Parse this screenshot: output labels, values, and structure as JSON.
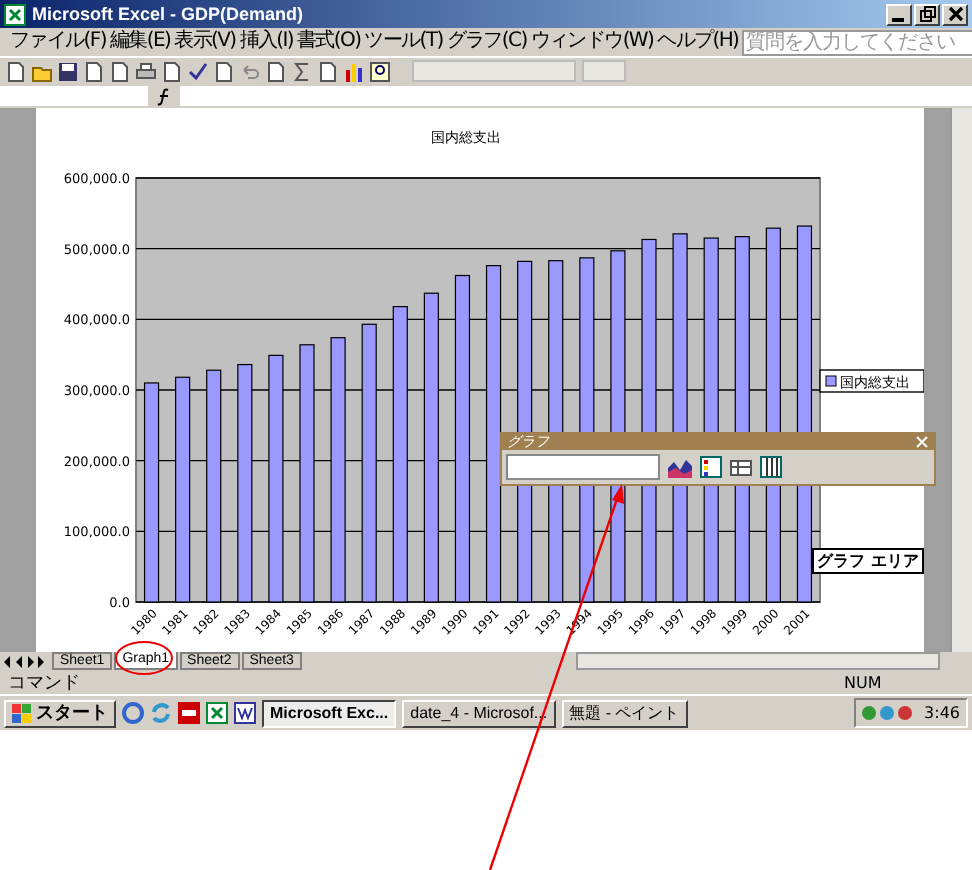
{
  "window": {
    "title": "Microsoft Excel - GDP(Demand)"
  },
  "menu": [
    "ファイル(F)",
    "編集(E)",
    "表示(V)",
    "挿入(I)",
    "書式(O)",
    "ツール(T)",
    "グラフ(C)",
    "ウィンドウ(W)",
    "ヘルプ(H)"
  ],
  "help_box": {
    "placeholder": "質問を入力してください"
  },
  "chart": {
    "chart_data": {
      "type": "bar",
      "title": "国内総支出",
      "categories": [
        "1980",
        "1981",
        "1982",
        "1983",
        "1984",
        "1985",
        "1986",
        "1987",
        "1988",
        "1989",
        "1990",
        "1991",
        "1992",
        "1993",
        "1994",
        "1995",
        "1996",
        "1997",
        "1998",
        "1999",
        "2000",
        "2001"
      ],
      "series": [
        {
          "name": "国内総支出",
          "color": "#9999ff",
          "values": [
            310000,
            318000,
            328000,
            336000,
            349000,
            364000,
            374000,
            393000,
            418000,
            437000,
            462000,
            476000,
            482000,
            483000,
            487000,
            497000,
            513000,
            521000,
            515000,
            517000,
            529000,
            532000
          ]
        }
      ],
      "ylim": [
        0,
        600000
      ],
      "grid": true,
      "yticks": [
        {
          "value": 0,
          "label": "0.0"
        },
        {
          "value": 100000,
          "label": "100,000.0"
        },
        {
          "value": 200000,
          "label": "200,000.0"
        },
        {
          "value": 300000,
          "label": "300,000.0"
        },
        {
          "value": 400000,
          "label": "400,000.0"
        },
        {
          "value": 500000,
          "label": "500,000.0"
        },
        {
          "value": 600000,
          "label": "600,000.0"
        }
      ]
    },
    "legend": true
  },
  "chart_toolbar": {
    "title": "グラフ"
  },
  "tooltip": "グラフ エリア",
  "sheet_tabs": [
    {
      "label": "Sheet1",
      "selected": false
    },
    {
      "label": "Graph1",
      "selected": true
    },
    {
      "label": "Sheet2",
      "selected": false
    },
    {
      "label": "Sheet3",
      "selected": false
    }
  ],
  "status_bar": {
    "mode": "コマンド",
    "num": "NUM"
  },
  "taskbar": {
    "start": "スタート",
    "tasks": [
      {
        "label": "Microsoft Exc...",
        "selected": true
      },
      {
        "label": "date_4 - Microsof...",
        "selected": false
      },
      {
        "label": "無題 - ペイント",
        "selected": false
      }
    ],
    "clock": "3:46"
  }
}
